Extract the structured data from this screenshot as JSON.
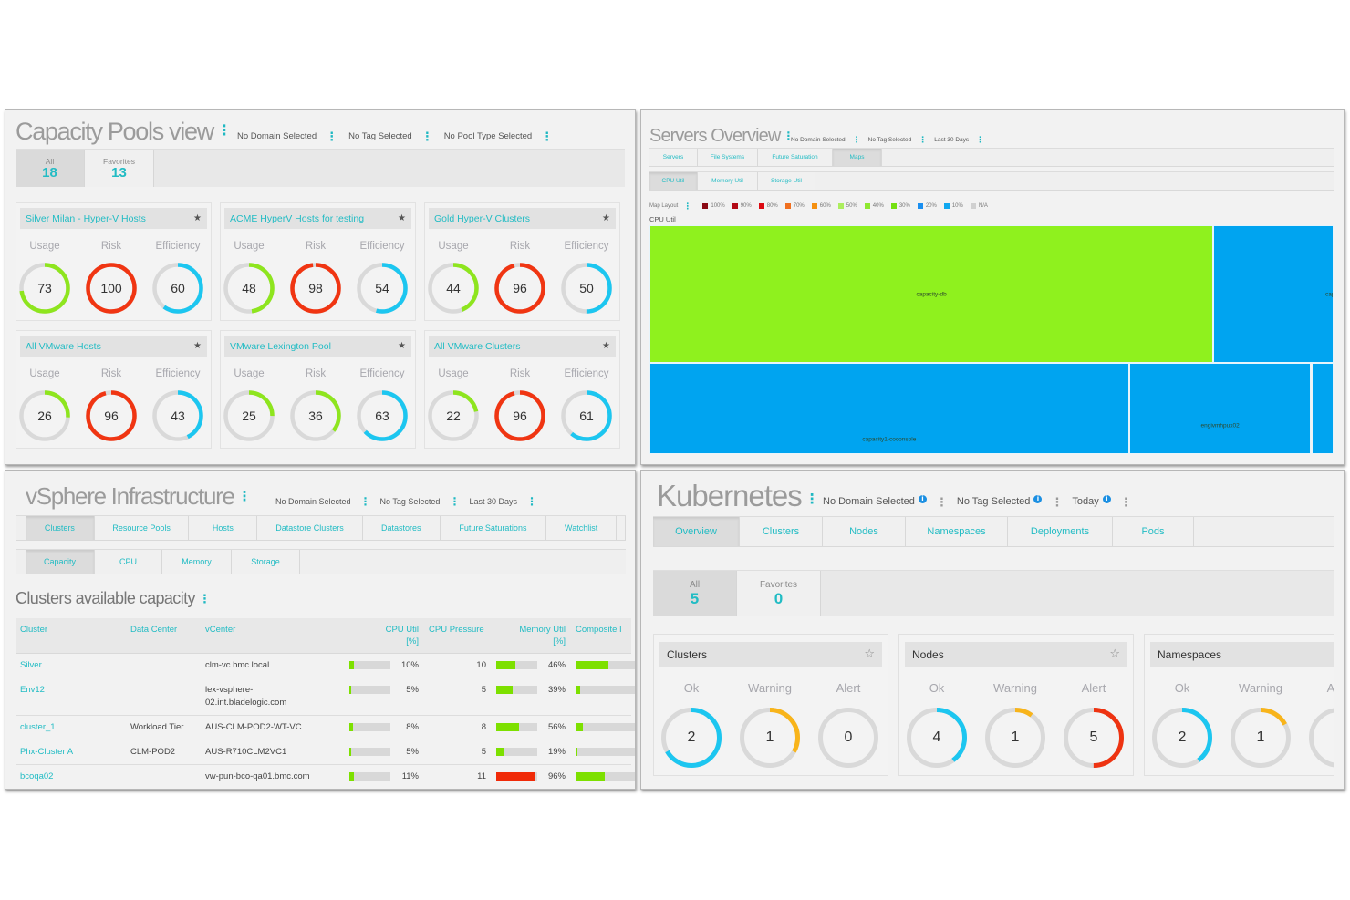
{
  "capacity_pools": {
    "title": "Capacity Pools view",
    "filters": [
      "No Domain Selected",
      "No Tag Selected",
      "No Pool Type Selected"
    ],
    "count_tabs": [
      {
        "label": "All",
        "count": "18",
        "selected": true
      },
      {
        "label": "Favorites",
        "count": "13",
        "selected": false
      }
    ],
    "metric_labels": [
      "Usage",
      "Risk",
      "Efficiency"
    ],
    "pools": [
      {
        "name": "Silver Milan - Hyper-V Hosts",
        "favorite": true,
        "metrics": [
          {
            "value": 73,
            "color": "#8ee51e"
          },
          {
            "value": 100,
            "color": "#f03512"
          },
          {
            "value": 60,
            "color": "#1cc6f0"
          }
        ]
      },
      {
        "name": "ACME HyperV Hosts for testing",
        "favorite": true,
        "metrics": [
          {
            "value": 48,
            "color": "#8ee51e"
          },
          {
            "value": 98,
            "color": "#f03512"
          },
          {
            "value": 54,
            "color": "#1cc6f0"
          }
        ]
      },
      {
        "name": "Gold Hyper-V Clusters",
        "favorite": true,
        "metrics": [
          {
            "value": 44,
            "color": "#8ee51e"
          },
          {
            "value": 96,
            "color": "#f03512"
          },
          {
            "value": 50,
            "color": "#1cc6f0"
          }
        ]
      },
      {
        "name": "All VMware Hosts",
        "favorite": true,
        "metrics": [
          {
            "value": 26,
            "color": "#8ee51e"
          },
          {
            "value": 96,
            "color": "#f03512"
          },
          {
            "value": 43,
            "color": "#1cc6f0"
          }
        ]
      },
      {
        "name": "VMware Lexington Pool",
        "favorite": true,
        "metrics": [
          {
            "value": 25,
            "color": "#8ee51e"
          },
          {
            "value": 36,
            "color": "#8ee51e"
          },
          {
            "value": 63,
            "color": "#1cc6f0"
          }
        ]
      },
      {
        "name": "All VMware Clusters",
        "favorite": true,
        "metrics": [
          {
            "value": 22,
            "color": "#8ee51e"
          },
          {
            "value": 96,
            "color": "#f03512"
          },
          {
            "value": 61,
            "color": "#1cc6f0"
          }
        ]
      }
    ]
  },
  "servers_overview": {
    "title": "Servers Overview",
    "filters": [
      "No Domain Selected",
      "No Tag Selected",
      "Last 30 Days"
    ],
    "tabs": [
      {
        "label": "Servers",
        "selected": false
      },
      {
        "label": "File Systems",
        "selected": false
      },
      {
        "label": "Future Saturation",
        "selected": false
      },
      {
        "label": "Maps",
        "selected": true
      }
    ],
    "subtabs": [
      {
        "label": "CPU Util",
        "selected": true
      },
      {
        "label": "Memory Util",
        "selected": false
      },
      {
        "label": "Storage Util",
        "selected": false
      }
    ],
    "legend": {
      "label": "Map Layout",
      "items": [
        {
          "label": "100%",
          "color": "#8b0a14"
        },
        {
          "label": "90%",
          "color": "#b30a16"
        },
        {
          "label": "80%",
          "color": "#dc0a12"
        },
        {
          "label": "70%",
          "color": "#f07020"
        },
        {
          "label": "60%",
          "color": "#f59010"
        },
        {
          "label": "50%",
          "color": "#acee5e"
        },
        {
          "label": "40%",
          "color": "#8ee830"
        },
        {
          "label": "30%",
          "color": "#74e010"
        },
        {
          "label": "20%",
          "color": "#1a8ff0"
        },
        {
          "label": "10%",
          "color": "#10a8f0"
        },
        {
          "label": "N/A",
          "color": "#d0d0d0"
        }
      ]
    },
    "map_title": "CPU Util",
    "treemap": {
      "rows": [
        {
          "items": [
            {
              "label": "capacity-db",
              "share": 49.7,
              "color": "#8ff11e"
            },
            {
              "label": "cap",
              "share": 10.6,
              "color": "#00a4f0"
            }
          ]
        },
        {
          "items": [
            {
              "label": "capacity1-coconsole",
              "share": 27.9,
              "color": "#00a4f0"
            },
            {
              "label": "engivmhpux02",
              "share": 10.6,
              "color": "#00a4f0"
            },
            {
              "label": "",
              "share": 1.3,
              "color": "#00a4f0"
            }
          ]
        }
      ]
    }
  },
  "vsphere": {
    "title": "vSphere Infrastructure",
    "filters": [
      "No Domain Selected",
      "No Tag Selected",
      "Last 30 Days"
    ],
    "tabs": [
      {
        "label": "Clusters",
        "selected": true
      },
      {
        "label": "Resource Pools",
        "selected": false
      },
      {
        "label": "Hosts",
        "selected": false
      },
      {
        "label": "Datastore Clusters",
        "selected": false
      },
      {
        "label": "Datastores",
        "selected": false
      },
      {
        "label": "Future Saturations",
        "selected": false
      },
      {
        "label": "Watchlist",
        "selected": false
      },
      {
        "label": "",
        "selected": false
      }
    ],
    "subtabs": [
      {
        "label": "Capacity",
        "selected": true
      },
      {
        "label": "CPU",
        "selected": false
      },
      {
        "label": "Memory",
        "selected": false
      },
      {
        "label": "Storage",
        "selected": false
      }
    ],
    "section_title": "Clusters available capacity",
    "table": {
      "columns": {
        "cluster": "Cluster",
        "data_center": "Data Center",
        "vcenter": "vCenter",
        "cpu_util": "CPU Util [%]",
        "cpu_pressure": "CPU Pressure",
        "memory_util": "Memory Util [%]",
        "composite": "Composite I"
      },
      "rows": [
        {
          "cluster": "Silver",
          "data_center": "",
          "vcenter": "clm-vc.bmc.local",
          "cpu_util": "10%",
          "cpu_util_frac": 0.1,
          "cpu_pressure": "10",
          "memory_util": "46%",
          "memory_util_frac": 0.46,
          "memory_color": "#7de000",
          "composite_frac": 0.55,
          "composite_color": "#7de000"
        },
        {
          "cluster": "Env12",
          "data_center": "",
          "vcenter": "lex-vsphere-02.int.bladelogic.com",
          "cpu_util": "5%",
          "cpu_util_frac": 0.05,
          "cpu_pressure": "5",
          "memory_util": "39%",
          "memory_util_frac": 0.39,
          "memory_color": "#7de000",
          "composite_frac": 0.08,
          "composite_color": "#7de000"
        },
        {
          "cluster": "cluster_1",
          "data_center": "Workload Tier",
          "vcenter": "AUS-CLM-POD2-WT-VC",
          "cpu_util": "8%",
          "cpu_util_frac": 0.08,
          "cpu_pressure": "8",
          "memory_util": "56%",
          "memory_util_frac": 0.56,
          "memory_color": "#7de000",
          "composite_frac": 0.12,
          "composite_color": "#7de000"
        },
        {
          "cluster": "Phx-Cluster A",
          "data_center": "CLM-POD2",
          "vcenter": "AUS-R710CLM2VC1",
          "cpu_util": "5%",
          "cpu_util_frac": 0.05,
          "cpu_pressure": "5",
          "memory_util": "19%",
          "memory_util_frac": 0.19,
          "memory_color": "#7de000",
          "composite_frac": 0.03,
          "composite_color": "#7de000"
        },
        {
          "cluster": "bcoqa02",
          "data_center": "",
          "vcenter": "vw-pun-bco-qa01.bmc.com",
          "cpu_util": "11%",
          "cpu_util_frac": 0.11,
          "cpu_pressure": "11",
          "memory_util": "96%",
          "memory_util_frac": 0.96,
          "memory_color": "#f02a08",
          "composite_frac": 0.49,
          "composite_color": "#7de000"
        }
      ]
    }
  },
  "kubernetes": {
    "title": "Kubernetes",
    "filters": [
      "No Domain Selected",
      "No Tag Selected",
      "Today"
    ],
    "tabs": [
      {
        "label": "Overview",
        "selected": true
      },
      {
        "label": "Clusters",
        "selected": false
      },
      {
        "label": "Nodes",
        "selected": false
      },
      {
        "label": "Namespaces",
        "selected": false
      },
      {
        "label": "Deployments",
        "selected": false
      },
      {
        "label": "Pods",
        "selected": false
      }
    ],
    "count_tabs": [
      {
        "label": "All",
        "count": "5",
        "selected": true
      },
      {
        "label": "Favorites",
        "count": "0",
        "selected": false
      }
    ],
    "status_labels": [
      "Ok",
      "Warning",
      "Alert"
    ],
    "cards": [
      {
        "title": "Clusters",
        "favorite": false,
        "statuses": [
          {
            "value": "2",
            "fraction": 0.667,
            "color": "#1cc6f0"
          },
          {
            "value": "1",
            "fraction": 0.333,
            "color": "#f8b41a"
          },
          {
            "value": "0",
            "fraction": 0,
            "color": "#ee3311"
          }
        ]
      },
      {
        "title": "Nodes",
        "favorite": false,
        "statuses": [
          {
            "value": "4",
            "fraction": 0.4,
            "color": "#1cc6f0"
          },
          {
            "value": "1",
            "fraction": 0.1,
            "color": "#f8b41a"
          },
          {
            "value": "5",
            "fraction": 0.5,
            "color": "#ee3311"
          }
        ]
      },
      {
        "title": "Namespaces",
        "favorite": false,
        "statuses": [
          {
            "value": "2",
            "fraction": 0.4,
            "color": "#1cc6f0"
          },
          {
            "value": "1",
            "fraction": 0.17,
            "color": "#f8b41a"
          },
          {
            "value": "",
            "fraction": 0,
            "color": "#ee3311"
          }
        ]
      }
    ]
  }
}
